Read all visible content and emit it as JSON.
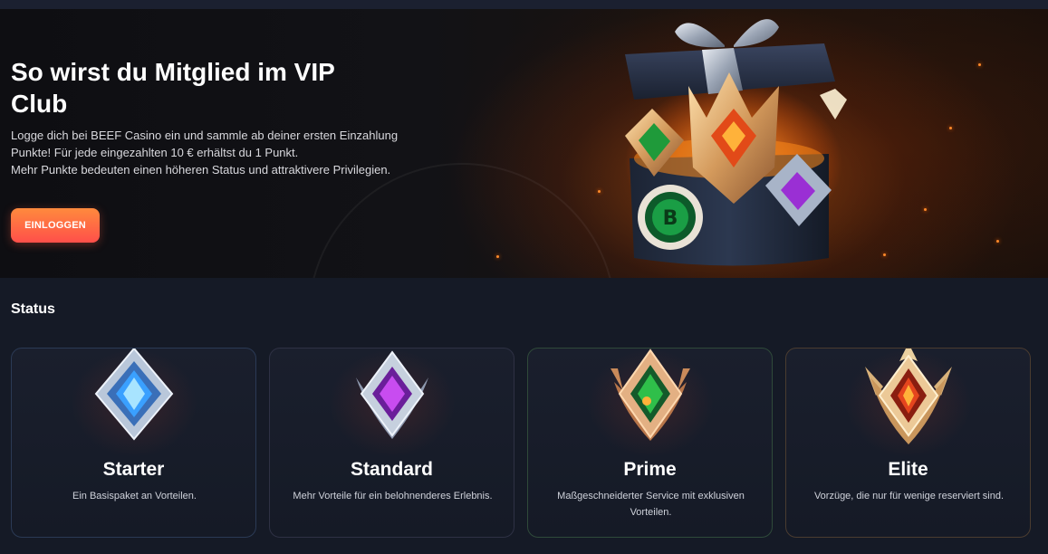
{
  "hero": {
    "title": "So wirst du Mitglied im VIP Club",
    "description_line1": "Logge dich bei BEEF Casino ein und sammle ab deiner ersten Einzahlung Punkte! Für jede eingezahlten 10 € erhältst du 1 Punkt.",
    "description_line2": "Mehr Punkte bedeuten einen höheren Status und attraktivere Privilegien.",
    "login_label": "EINLOGGEN",
    "art_icon": "gift-box-with-gems-icon"
  },
  "status": {
    "title": "Status",
    "tiers": [
      {
        "name": "Starter",
        "description": "Ein Basispaket an Vorteilen.",
        "gem_color": "#3aa0ff",
        "frame_color": "#aebfd6",
        "icon": "starter-badge-icon"
      },
      {
        "name": "Standard",
        "description": "Mehr Vorteile für ein belohnenderes Erlebnis.",
        "gem_color": "#b338e6",
        "frame_color": "#b8c2d3",
        "icon": "standard-badge-icon"
      },
      {
        "name": "Prime",
        "description": "Maßgeschneiderter Service mit exklusiven Vorteilen.",
        "gem_color": "#2fbf4a",
        "frame_color": "#d39a6a",
        "icon": "prime-badge-icon"
      },
      {
        "name": "Elite",
        "description": "Vorzüge, die nur für wenige reserviert sind.",
        "gem_color": "#e5451e",
        "frame_color": "#e6c18a",
        "icon": "elite-badge-icon"
      }
    ]
  },
  "colors": {
    "accent_start": "#ff8a3d",
    "accent_end": "#ff4f4a",
    "page_background": "#151a26"
  }
}
